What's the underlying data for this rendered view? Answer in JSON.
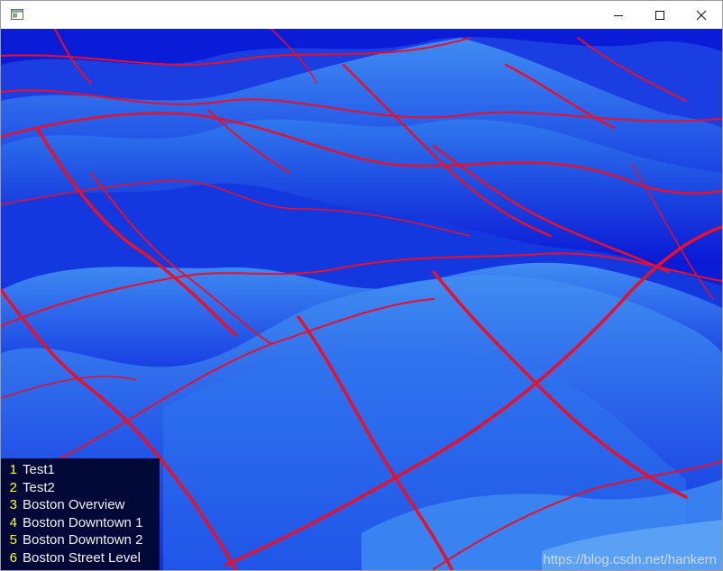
{
  "window": {
    "icon": "window-app-icon",
    "controls": {
      "minimize_icon": "minimize-icon",
      "maximize_icon": "maximize-icon",
      "close_icon": "close-icon"
    }
  },
  "scene": {
    "description_icon": "terrain-3d-view",
    "colors": {
      "terrain_dark": "#0a12d8",
      "terrain_light": "#3a88f0",
      "grid_lines": "#e8102a"
    }
  },
  "menu": {
    "items": [
      {
        "key": "1",
        "label": "Test1"
      },
      {
        "key": "2",
        "label": "Test2"
      },
      {
        "key": "3",
        "label": "Boston Overview"
      },
      {
        "key": "4",
        "label": "Boston Downtown 1"
      },
      {
        "key": "5",
        "label": "Boston Downtown 2"
      },
      {
        "key": "6",
        "label": "Boston Street Level"
      }
    ],
    "colors": {
      "key": "#ffff33",
      "label": "#f2f2f2"
    }
  },
  "watermark": {
    "text": "https://blog.csdn.net/hankern"
  }
}
